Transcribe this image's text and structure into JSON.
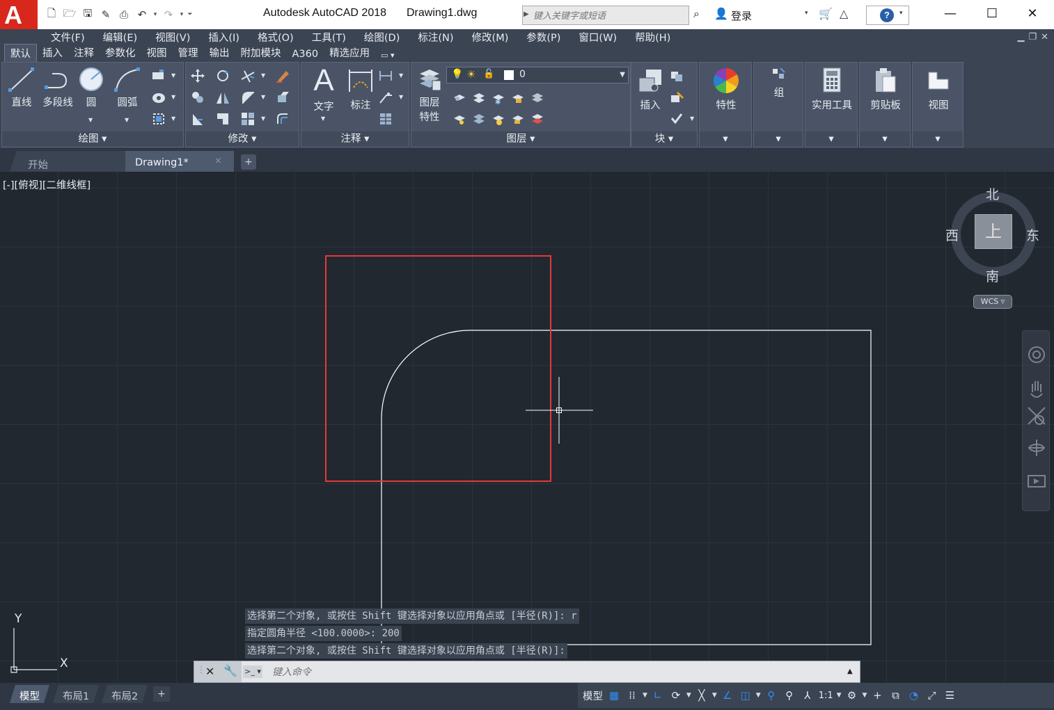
{
  "window": {
    "app_title": "Autodesk AutoCAD 2018",
    "file_name": "Drawing1.dwg",
    "logo_letter": "A",
    "search_placeholder": "键入关键字或短语",
    "login_label": "登录",
    "help_label": "?"
  },
  "menubar": [
    "文件(F)",
    "编辑(E)",
    "视图(V)",
    "插入(I)",
    "格式(O)",
    "工具(T)",
    "绘图(D)",
    "标注(N)",
    "修改(M)",
    "参数(P)",
    "窗口(W)",
    "帮助(H)"
  ],
  "ribbon_tabs": [
    "默认",
    "插入",
    "注释",
    "参数化",
    "视图",
    "管理",
    "输出",
    "附加模块",
    "A360",
    "精选应用"
  ],
  "ribbon": {
    "draw": {
      "title": "绘图",
      "line": "直线",
      "polyline": "多段线",
      "circle": "圆",
      "arc": "圆弧"
    },
    "modify": {
      "title": "修改"
    },
    "annotation": {
      "title": "注释",
      "text": "文字",
      "dimension": "标注"
    },
    "layers": {
      "title": "图层",
      "layer_props_1": "图层",
      "layer_props_2": "特性",
      "current_layer": "0"
    },
    "block": {
      "title": "块",
      "insert": "插入"
    },
    "properties": {
      "label": "特性"
    },
    "groups": {
      "label": "组"
    },
    "utilities": {
      "label": "实用工具"
    },
    "clipboard": {
      "label": "剪贴板"
    },
    "view": {
      "label": "视图"
    }
  },
  "file_tabs": {
    "start": "开始",
    "drawing": "Drawing1*",
    "close": "×",
    "add": "+"
  },
  "viewport": {
    "label": "[-][俯视][二维线框]"
  },
  "viewcube": {
    "north": "北",
    "south": "南",
    "east": "东",
    "west": "西",
    "top": "上",
    "wcs": "WCS"
  },
  "ucs": {
    "x": "X",
    "y": "Y"
  },
  "command_history": [
    "选择第二个对象, 或按住 Shift 键选择对象以应用角点或 [半径(R)]: r",
    "指定圆角半径 <100.0000>: 200",
    "选择第二个对象, 或按住 Shift 键选择对象以应用角点或 [半径(R)]:"
  ],
  "command_line": {
    "placeholder": "键入命令"
  },
  "layout_tabs": [
    "模型",
    "布局1",
    "布局2"
  ],
  "status_bar": {
    "model_label": "模型",
    "scale": "1:1"
  },
  "colors": {
    "highlight_rect": "#e8383a",
    "geometry": "#ffffff",
    "canvas_bg": "#212830",
    "ribbon_bg": "#3b4453",
    "logo_red": "#d8281c"
  }
}
